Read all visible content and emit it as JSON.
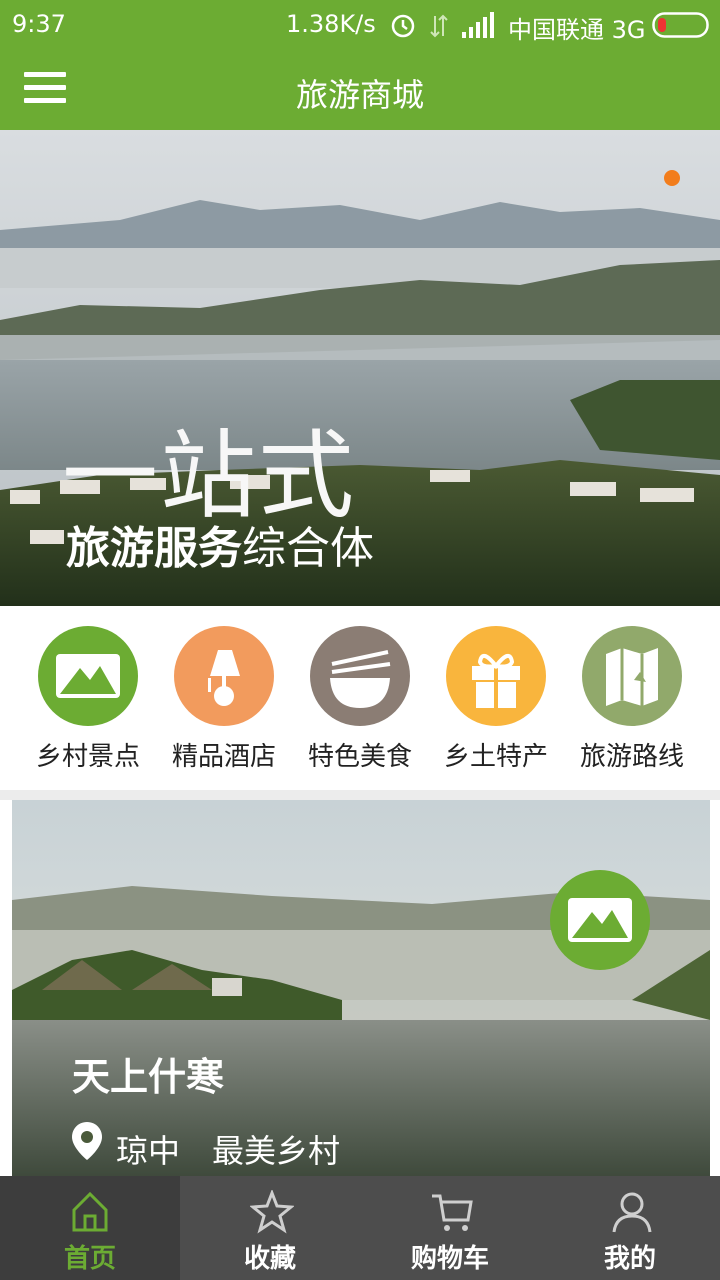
{
  "status_bar": {
    "time": "9:37",
    "speed": "1.38K/s",
    "carrier": "中国联通 3G"
  },
  "app_bar": {
    "title": "旅游商城",
    "menu_icon": "hamburger-menu-icon",
    "color": "#6cac33"
  },
  "banner": {
    "headline": "一站式",
    "subline_bold": "旅游服务",
    "subline_light": "综合体",
    "indicator_color": "#f27d1c"
  },
  "categories": [
    {
      "label": "乡村景点",
      "icon": "mountain-icon",
      "color": "#6cac33"
    },
    {
      "label": "精品酒店",
      "icon": "lamp-icon",
      "color": "#f29b5d"
    },
    {
      "label": "特色美食",
      "icon": "bowl-icon",
      "color": "#8b7d74"
    },
    {
      "label": "乡土特产",
      "icon": "gift-icon",
      "color": "#f9b53d"
    },
    {
      "label": "旅游路线",
      "icon": "map-icon",
      "color": "#91a96b"
    }
  ],
  "feature": {
    "title": "天上什寒",
    "location": "琼中",
    "tag": "最美乡村",
    "badge_icon": "mountain-icon"
  },
  "bottom_nav": {
    "active_color": "#6cac33",
    "items": [
      {
        "label": "首页",
        "icon": "home-icon",
        "active": true
      },
      {
        "label": "收藏",
        "icon": "star-icon",
        "active": false
      },
      {
        "label": "购物车",
        "icon": "cart-icon",
        "active": false
      },
      {
        "label": "我的",
        "icon": "user-icon",
        "active": false
      }
    ]
  }
}
